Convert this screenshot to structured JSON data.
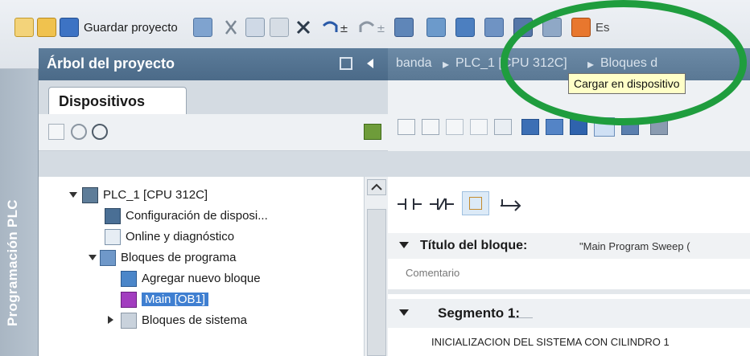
{
  "toolbar": {
    "save_project_label": "Guardar proyecto",
    "icons": [
      "new-project-icon",
      "open-project-icon",
      "save-icon",
      "print-icon",
      "cut-icon",
      "copy-icon",
      "paste-icon",
      "delete-icon",
      "undo-icon",
      "redo-icon",
      "compile-icon",
      "download-icon",
      "upload-icon",
      "go-online-icon",
      "go-offline-icon",
      "monitor-icon"
    ],
    "partial_text": "Es"
  },
  "side_strip": {
    "label": "Programación PLC"
  },
  "project_tree": {
    "title": "Árbol del proyecto",
    "tab": "Dispositivos",
    "items": [
      {
        "label": "PLC_1 [CPU 312C]",
        "level": 0,
        "expanded": true
      },
      {
        "label": "Configuración de disposi...",
        "level": 1
      },
      {
        "label": "Online y diagnóstico",
        "level": 1
      },
      {
        "label": "Bloques de programa",
        "level": 1,
        "expanded": true
      },
      {
        "label": "Agregar nuevo bloque",
        "level": 2
      },
      {
        "label": "Main [OB1]",
        "level": 2,
        "selected": true
      },
      {
        "label": "Bloques de sistema",
        "level": 2,
        "expanded": false
      }
    ]
  },
  "editor": {
    "breadcrumb": [
      "banda",
      "PLC_1 [CPU 312C]",
      "Bloques d"
    ],
    "block_title_label": "Título del bloque:",
    "block_title_value": "\"Main Program Sweep (",
    "comment_placeholder": "Comentario",
    "segment_label": "Segmento 1:",
    "segment_comment": "INICIALIZACION DEL SISTEMA CON CILINDRO 1"
  },
  "tooltip": {
    "text": "Cargar en dispositivo"
  },
  "colors": {
    "highlight": "#1f9d3e",
    "tree_header": "#4b6a88",
    "selection": "#3f7fd1",
    "tooltip_bg": "#ffffc8"
  }
}
